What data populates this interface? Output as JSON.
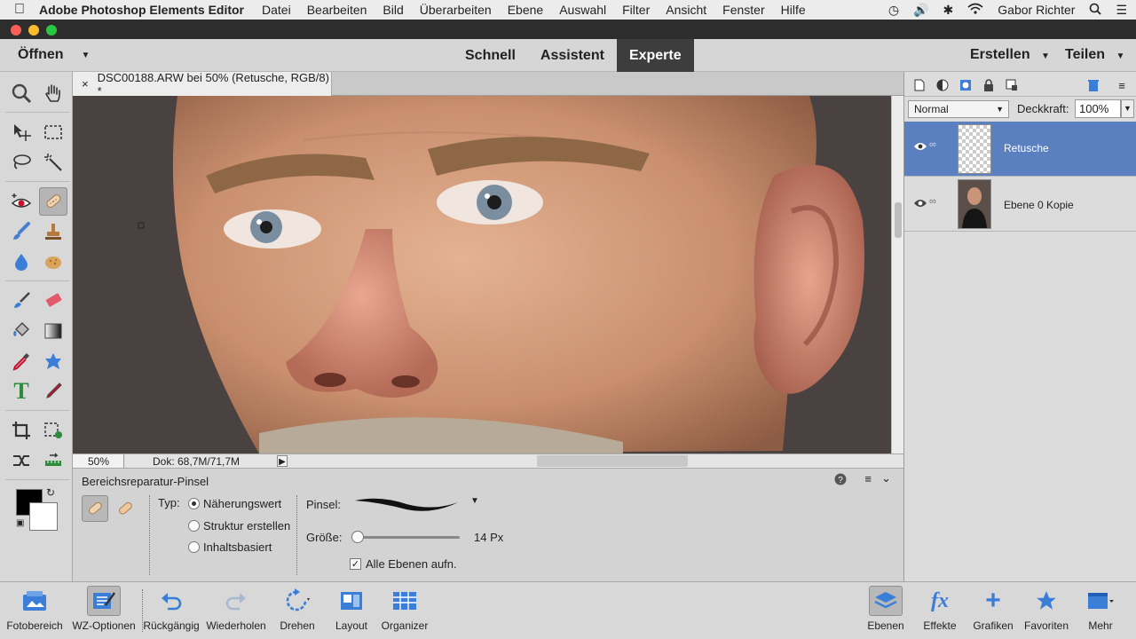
{
  "menubar": {
    "app_name": "Adobe Photoshop Elements Editor",
    "items": [
      "Datei",
      "Bearbeiten",
      "Bild",
      "Überarbeiten",
      "Ebene",
      "Auswahl",
      "Filter",
      "Ansicht",
      "Fenster",
      "Hilfe"
    ],
    "user": "Gabor Richter"
  },
  "topbar": {
    "open_label": "Öffnen",
    "modes": [
      "Schnell",
      "Assistent",
      "Experte"
    ],
    "active_mode": "Experte",
    "create_label": "Erstellen",
    "share_label": "Teilen"
  },
  "document": {
    "tab_title": "DSC00188.ARW bei 50% (Retusche, RGB/8) *",
    "zoom": "50%",
    "doc_info": "Dok: 68,7M/71,7M"
  },
  "tool_options": {
    "tool_name": "Bereichsreparatur-Pinsel",
    "type_label": "Typ:",
    "types": [
      "Näherungswert",
      "Struktur erstellen",
      "Inhaltsbasiert"
    ],
    "selected_type": "Näherungswert",
    "brush_label": "Pinsel:",
    "size_label": "Größe:",
    "size_value": "14 Px",
    "size_fraction": 0.02,
    "sample_all_label": "Alle Ebenen aufn.",
    "sample_all_checked": true
  },
  "layers_panel": {
    "blend_mode": "Normal",
    "opacity_label": "Deckkraft:",
    "opacity_value": "100%",
    "layers": [
      {
        "name": "Retusche",
        "selected": true
      },
      {
        "name": "Ebene 0 Kopie",
        "selected": false
      }
    ]
  },
  "bottombar": {
    "left": [
      {
        "label": "Fotobereich",
        "icon": "photo-bin-icon"
      },
      {
        "label": "WZ-Optionen",
        "icon": "tool-options-icon"
      },
      {
        "label": "Rückgängig",
        "icon": "undo-icon"
      },
      {
        "label": "Wiederholen",
        "icon": "redo-icon"
      },
      {
        "label": "Drehen",
        "icon": "rotate-icon"
      },
      {
        "label": "Layout",
        "icon": "layout-icon"
      },
      {
        "label": "Organizer",
        "icon": "organizer-icon"
      }
    ],
    "right": [
      {
        "label": "Ebenen",
        "icon": "layers-icon"
      },
      {
        "label": "Effekte",
        "icon": "effects-icon"
      },
      {
        "label": "Grafiken",
        "icon": "graphics-icon"
      },
      {
        "label": "Favoriten",
        "icon": "favorites-icon"
      },
      {
        "label": "Mehr",
        "icon": "more-icon"
      }
    ]
  },
  "colors": {
    "accent_selected_layer": "#5b80c0",
    "active_mode_bg": "#3d3d3d",
    "foreground": "#000000",
    "background": "#ffffff"
  }
}
